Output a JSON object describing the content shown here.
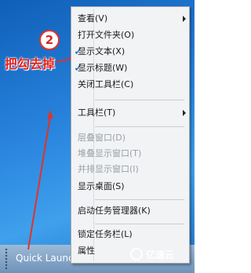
{
  "taskbar": {
    "quick_launch_label": "Quick Launch"
  },
  "menu": {
    "items": [
      {
        "label": "查看(V)",
        "submenu": true
      },
      {
        "label": "打开文件夹(O)"
      },
      {
        "label": "显示文本(X)",
        "checked": true
      },
      {
        "label": "显示标题(W)",
        "checked": true
      },
      {
        "label": "关闭工具栏(C)"
      },
      {
        "label": "工具栏(T)",
        "submenu": true
      },
      {
        "label": "层叠窗口(D)",
        "disabled": true
      },
      {
        "label": "堆叠显示窗口(T)",
        "disabled": true
      },
      {
        "label": "并排显示窗口(I)",
        "disabled": true
      },
      {
        "label": "显示桌面(S)"
      },
      {
        "label": "启动任务管理器(K)"
      },
      {
        "label": "锁定任务栏(L)"
      },
      {
        "label": "属性"
      }
    ],
    "check_glyph": "✓"
  },
  "annotation": {
    "step_number": "2",
    "instruction": "把勾去掉",
    "color": "#e0332b"
  },
  "watermark": {
    "text": "亿速云"
  }
}
